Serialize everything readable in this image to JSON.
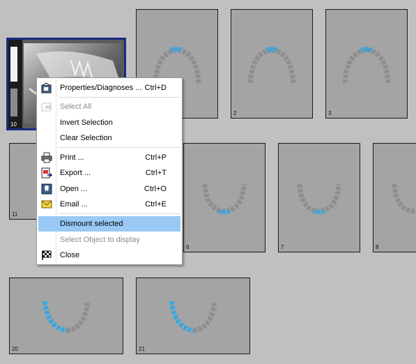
{
  "tiles": [
    {
      "number": "10"
    },
    {
      "number": ""
    },
    {
      "number": "2"
    },
    {
      "number": "3"
    },
    {
      "number": "11"
    },
    {
      "number": "6"
    },
    {
      "number": "7"
    },
    {
      "number": "8"
    },
    {
      "number": "20"
    },
    {
      "number": "21"
    }
  ],
  "context_menu": {
    "items": [
      {
        "label": "Properties/Diagnoses ...",
        "shortcut": "Ctrl+D",
        "icon": "properties-icon",
        "enabled": true
      },
      {
        "label": "Select All",
        "shortcut": "",
        "icon": "select-all-icon",
        "enabled": false
      },
      {
        "label": "Invert Selection",
        "shortcut": "",
        "icon": "",
        "enabled": true
      },
      {
        "label": "Clear Selection",
        "shortcut": "",
        "icon": "",
        "enabled": true
      },
      {
        "label": "Print ...",
        "shortcut": "Ctrl+P",
        "icon": "printer-icon",
        "enabled": true
      },
      {
        "label": "Export ...",
        "shortcut": "Ctrl+T",
        "icon": "export-icon",
        "enabled": true
      },
      {
        "label": "Open ...",
        "shortcut": "Ctrl+O",
        "icon": "open-tooth-icon",
        "enabled": true
      },
      {
        "label": "Email ...",
        "shortcut": "Ctrl+E",
        "icon": "email-icon",
        "enabled": true
      },
      {
        "label": "Dismount selected",
        "shortcut": "",
        "icon": "",
        "enabled": true,
        "highlighted": true
      },
      {
        "label": "Select Object to display",
        "shortcut": "",
        "icon": "",
        "enabled": false
      },
      {
        "label": "Close",
        "shortcut": "",
        "icon": "checkered-flag-icon",
        "enabled": true
      }
    ]
  },
  "colors": {
    "background": "#c0c0c0",
    "tile": "#a4a4a4",
    "selected_border": "#1b2a80",
    "highlight": "#99c9f4",
    "teeth_selected": "#3aa6e0",
    "teeth": "#8e8e8e"
  }
}
